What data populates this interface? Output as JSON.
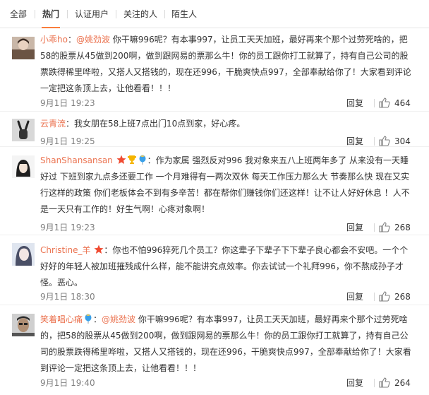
{
  "tabs": [
    "全部",
    "热门",
    "认证用户",
    "关注的人",
    "陌生人"
  ],
  "active_tab": "热门",
  "reply_label": "回复",
  "colors": {
    "accent": "#fa7d3c",
    "link": "#eb7350",
    "text": "#333333",
    "muted": "#808080"
  },
  "comments": [
    {
      "nick": "小乖ho",
      "sep": "：",
      "mention": "@姚劲波",
      "body": " 你干嘛996呢？有本事997，让员工天天加班，最好再来个那个过劳死啥的，把58的股票从45做到200啊，做到跟网易的票那么牛！你的员工跟你打工就算了，持有自己公司的股票跌得稀里哗啦，又搭人又搭钱的，现在还996，干脆爽快点997，全部奉献给你了！大家看到评论一定把这条顶上去，让他看看！！！",
      "time": "9月1日 19:23",
      "likes": "464",
      "badges": []
    },
    {
      "nick": "云青流",
      "sep": "：",
      "mention": "",
      "body": "我女朋在58上班7点出门10点到家，好心疼。",
      "time": "9月1日 19:25",
      "likes": "304",
      "badges": []
    },
    {
      "nick": "ShanShansansan",
      "sep": "：",
      "mention": "",
      "body": "作为家属 强烈反对996 我对象来五八上班两年多了 从来没有一天睡好过 下班到家九点多还要工作 一个月难得有一两次双休 每天工作压力那么大 节奏那么快 现在又实行这样的政策 你们老板体会不到有多辛苦！都在帮你们赚钱你们还这样！让不让人好好休息 ！人不是一天只有工作的！好生气啊！心疼对象啊！",
      "time": "9月1日 19:23",
      "likes": "268",
      "badges": [
        "star-badge-icon",
        "trophy-badge-icon",
        "balloon-badge-icon"
      ]
    },
    {
      "nick": "Christine_羊",
      "sep": "：",
      "mention": "",
      "body": "你也不怕996猝死几个员工？你这辈子下辈子下下辈子良心都会不安吧。一个个好好的年轻人被加班摧残成什么样，能不能讲究点效率。你去试试一个礼拜996，你不熬成孙子才怪。恶心。",
      "time": "9月1日 18:30",
      "likes": "268",
      "badges": [
        "star-badge-icon"
      ]
    },
    {
      "nick": "笑着唱心痛",
      "sep": "：",
      "mention": "@姚劲波",
      "body": " 你干嘛996呢？有本事997，让员工天天加班，最好再来个那个过劳死啥的，把58的股票从45做到200啊，做到跟网易的票那么牛！你的员工跟你打工就算了，持有自己公司的股票跌得稀里哗啦，又搭人又搭钱的，现在还996，干脆爽快点997，全部奉献给你了！大家看到评论一定把这条顶上去，让他看看！！！",
      "time": "9月1日 19:40",
      "likes": "264",
      "badges": [
        "balloon-badge-icon"
      ]
    }
  ]
}
